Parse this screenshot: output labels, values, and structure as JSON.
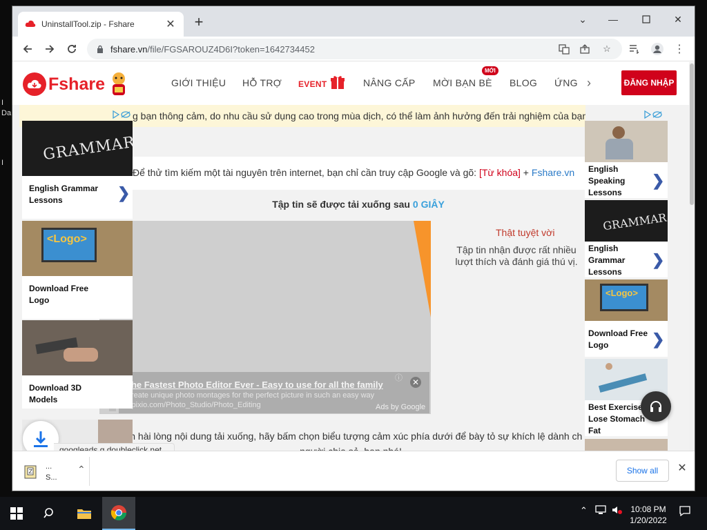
{
  "desktop": {
    "frag1": "I",
    "frag2": "Da",
    "frag3": "I"
  },
  "browser": {
    "tab_title": "UninstallTool.zip - Fshare",
    "url_host": "fshare.vn",
    "url_path": "/file/FGSAROUZ4D6I?token=1642734452"
  },
  "site": {
    "logo_text": "Fshare",
    "nav": [
      "GIỚI THIỆU",
      "HỖ TRỢ",
      "EVENT",
      "NÂNG CẤP",
      "MỜI BẠN BÈ",
      "BLOG",
      "ỨNG"
    ],
    "badge_new": "MỚI",
    "login": "ĐĂNG NHẬP",
    "notice": "g bạn thông cảm, do nhu cầu sử dụng cao trong mùa dịch, có thể làm ảnh hưởng đến trải nghiệm của bạn",
    "tip_prefix": "Để thử tìm kiếm một tài nguyên trên internet, bạn chỉ cần truy cập Google và gõ: ",
    "tip_keyword": "[Từ khóa]",
    "tip_plus": " + ",
    "tip_link": "Fshare.vn",
    "countdown_prefix": "Tập tin sẽ được tải xuống sau ",
    "countdown_num": "0",
    "countdown_unit": "GIÂY",
    "great_title": "Thật tuyệt vời",
    "great_desc": "Tập tin nhận được rất nhiều lượt thích và đánh giá thú vị.",
    "bottom_msg_line1": "bạn hài lòng nội dung tải xuống, hãy bấm chọn biểu tượng cảm xúc phía dưới để bày tỏ sự khích lệ dành ch",
    "bottom_msg_line2": "người chia sẻ, bạn nhé!"
  },
  "video_ad": {
    "title": "The Fastest Photo Editor Ever - Easy to use for all the family",
    "desc": "Create unique photo montages for the perfect picture in such an easy way",
    "url": "inpixio.com/Photo_Studio/Photo_Editing",
    "by": "Ads by Google"
  },
  "left_ads": [
    {
      "label": "English Grammar Lessons",
      "image_text": "GRAMMAR"
    },
    {
      "label": "Download Free Logo",
      "image_text": "<Logo>"
    },
    {
      "label": "Download 3D Models",
      "image_text": ""
    }
  ],
  "right_ads": [
    {
      "label": "English Speaking Lessons"
    },
    {
      "label": "English Grammar Lessons",
      "image_text": "GRAMMAR"
    },
    {
      "label": "Download Free Logo",
      "image_text": "<Logo>"
    },
    {
      "label": "Best Exercise To Lose Stomach Fat"
    }
  ],
  "status_url": "googleads.g.doubleclick.net...",
  "download_shelf": {
    "item_line1": "...",
    "item_line2": "S...",
    "show_all": "Show all"
  },
  "taskbar": {
    "time": "10:08 PM",
    "date": "1/20/2022"
  },
  "colors": {
    "brand_red": "#e62129",
    "login_red": "#d0021b",
    "link_blue": "#2a7ac7",
    "countdown_blue": "#39a0db",
    "notice_bg": "#fdf6d8"
  }
}
